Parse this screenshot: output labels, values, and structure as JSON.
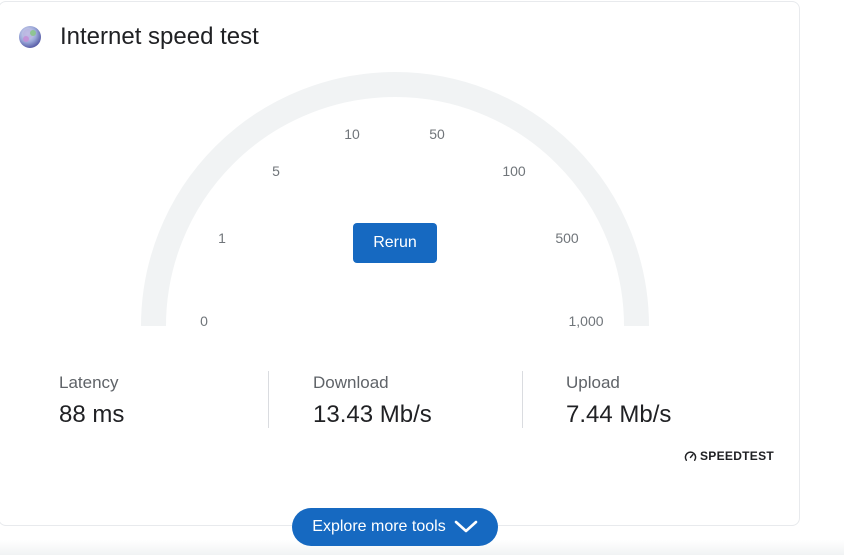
{
  "widget": {
    "title": "Internet speed test",
    "icon": "speedtest-globe-icon"
  },
  "gauge": {
    "scale_labels": [
      "0",
      "1",
      "5",
      "10",
      "50",
      "100",
      "500",
      "1,000"
    ],
    "track_color": "#f1f3f4"
  },
  "actions": {
    "rerun_label": "Rerun",
    "explore_label": "Explore more tools"
  },
  "stats": {
    "latency": {
      "label": "Latency",
      "value": "88 ms"
    },
    "download": {
      "label": "Download",
      "value": "13.43 Mb/s"
    },
    "upload": {
      "label": "Upload",
      "value": "7.44 Mb/s"
    }
  },
  "attribution": {
    "label": "SPEEDTEST"
  },
  "colors": {
    "accent": "#1669c1",
    "text_primary": "#202124",
    "text_secondary": "#70757a"
  }
}
